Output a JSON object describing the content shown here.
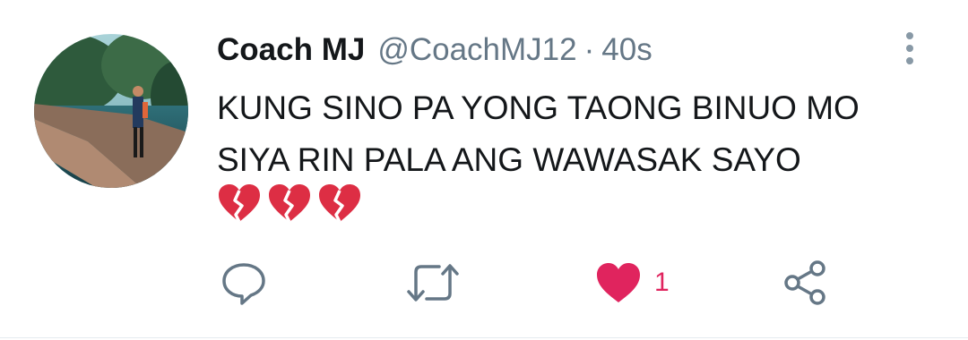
{
  "tweet": {
    "author_name": "Coach MJ",
    "handle": "@CoachMJ12",
    "separator": "·",
    "time": "40s",
    "text_lines": [
      "KUNG SINO PA YONG TAONG BINUO MO",
      "SIYA RIN PALA ANG WAWASAK SAYO"
    ],
    "emoji_names": [
      "broken-heart",
      "broken-heart",
      "broken-heart"
    ],
    "actions": {
      "reply_icon": "reply-icon",
      "retweet_icon": "retweet-icon",
      "like_icon": "heart-icon",
      "like_count": "1",
      "share_icon": "share-icon"
    },
    "colors": {
      "text": "#14171a",
      "secondary": "#657786",
      "like": "#e0245e",
      "broken_heart": "#dd2e44"
    }
  }
}
